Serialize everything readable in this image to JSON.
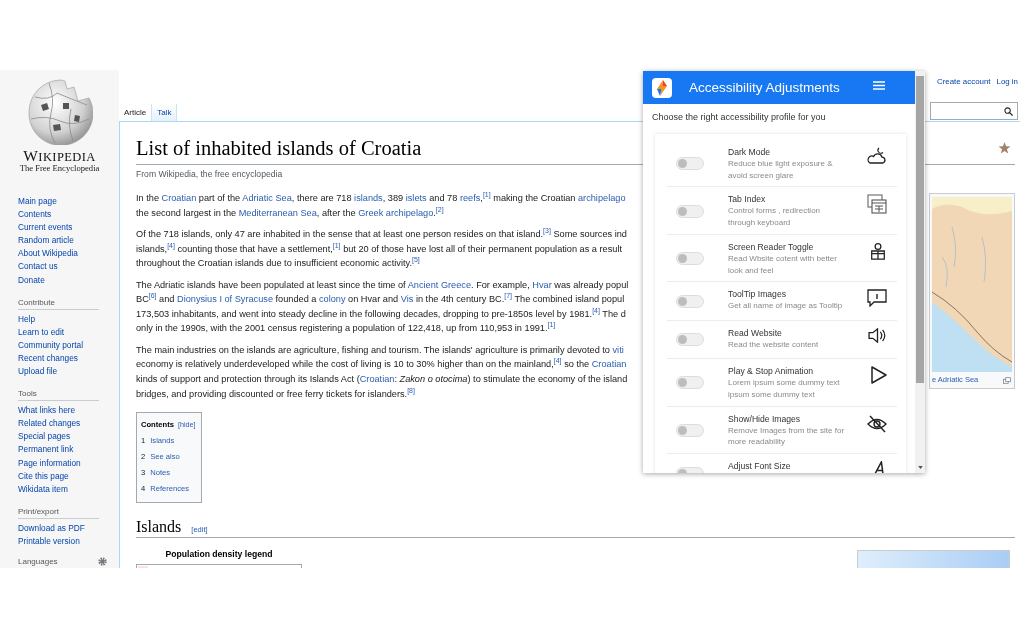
{
  "sidebar": {
    "wordmark": "WIKIPEDIA",
    "tagline": "The Free Encyclopedia",
    "sections": [
      {
        "items": [
          "Main page",
          "Contents",
          "Current events",
          "Random article",
          "About Wikipedia",
          "Contact us",
          "Donate"
        ]
      },
      {
        "heading": "Contribute",
        "items": [
          "Help",
          "Learn to edit",
          "Community portal",
          "Recent changes",
          "Upload file"
        ]
      },
      {
        "heading": "Tools",
        "items": [
          "What links here",
          "Related changes",
          "Special pages",
          "Permanent link",
          "Page information",
          "Cite this page",
          "Wikidata item"
        ]
      },
      {
        "heading": "Print/export",
        "items": [
          "Download as PDF",
          "Printable version"
        ]
      }
    ],
    "languages_heading": "Languages"
  },
  "tabs": [
    {
      "label": "Article",
      "selected": true
    },
    {
      "label": "Talk",
      "selected": false
    }
  ],
  "personal_links": [
    "Create account",
    "Log in"
  ],
  "article": {
    "title": "List of inhabited islands of Croatia",
    "tagline": "From Wikipedia, the free encyclopedia",
    "paragraphs": [
      {
        "lines": [
          [
            {
              "kind": "text",
              "text": "In the "
            },
            {
              "kind": "link",
              "text": "Croatian"
            },
            {
              "kind": "text",
              "text": " part of the "
            },
            {
              "kind": "link",
              "text": "Adriatic Sea"
            },
            {
              "kind": "text",
              "text": ", there are 718 "
            },
            {
              "kind": "link",
              "text": "islands"
            },
            {
              "kind": "text",
              "text": ", 389 "
            },
            {
              "kind": "link",
              "text": "islets"
            },
            {
              "kind": "text",
              "text": " and 78 "
            },
            {
              "kind": "link",
              "text": "reefs"
            },
            {
              "kind": "text",
              "text": ","
            },
            {
              "kind": "ref",
              "text": "[1]"
            },
            {
              "kind": "text",
              "text": " making the Croatian "
            },
            {
              "kind": "link",
              "text": "archipelago"
            }
          ],
          [
            {
              "kind": "text",
              "text": "the second largest in the "
            },
            {
              "kind": "link",
              "text": "Mediterranean Sea"
            },
            {
              "kind": "text",
              "text": ", after the "
            },
            {
              "kind": "link",
              "text": "Greek archipelago"
            },
            {
              "kind": "text",
              "text": "."
            },
            {
              "kind": "ref",
              "text": "[2]"
            }
          ]
        ]
      },
      {
        "lines": [
          [
            {
              "kind": "text",
              "text": "Of the 718 islands, only 47 are inhabited in the sense that at least one person resides on that island."
            },
            {
              "kind": "ref",
              "text": "[3]"
            },
            {
              "kind": "text",
              "text": " Some sources ind"
            }
          ],
          [
            {
              "kind": "text",
              "text": "islands,"
            },
            {
              "kind": "ref",
              "text": "[4]"
            },
            {
              "kind": "text",
              "text": " counting those that have a settlement,"
            },
            {
              "kind": "ref",
              "text": "[1]"
            },
            {
              "kind": "text",
              "text": " but 20 of those have lost all of their permanent population as a result"
            }
          ],
          [
            {
              "kind": "text",
              "text": "throughout the Croatian islands due to insufficient economic activity."
            },
            {
              "kind": "ref",
              "text": "[5]"
            }
          ]
        ]
      },
      {
        "lines": [
          [
            {
              "kind": "text",
              "text": "The Adriatic islands have been populated at least since the time of "
            },
            {
              "kind": "link",
              "text": "Ancient Greece"
            },
            {
              "kind": "text",
              "text": ". For example, "
            },
            {
              "kind": "link",
              "text": "Hvar"
            },
            {
              "kind": "text",
              "text": " was already popul"
            }
          ],
          [
            {
              "kind": "text",
              "text": "BC"
            },
            {
              "kind": "ref",
              "text": "[6]"
            },
            {
              "kind": "text",
              "text": " and "
            },
            {
              "kind": "link",
              "text": "Dionysius I of Syracuse"
            },
            {
              "kind": "text",
              "text": " founded a "
            },
            {
              "kind": "link",
              "text": "colony"
            },
            {
              "kind": "text",
              "text": " on Hvar and "
            },
            {
              "kind": "link",
              "text": "Vis"
            },
            {
              "kind": "text",
              "text": " in the 4th century BC."
            },
            {
              "kind": "ref",
              "text": "[7]"
            },
            {
              "kind": "text",
              "text": " The combined island popul"
            }
          ],
          [
            {
              "kind": "text",
              "text": "173,503 inhabitants, and went into steady decline in the following decades, dropping to pre-1850s level by 1981."
            },
            {
              "kind": "ref",
              "text": "[4]"
            },
            {
              "kind": "text",
              "text": " The d"
            }
          ],
          [
            {
              "kind": "text",
              "text": "only in the 1990s, with the 2001 census registering a population of 122,418, up from 110,953 in 1991."
            },
            {
              "kind": "ref",
              "text": "[1]"
            }
          ]
        ]
      },
      {
        "lines": [
          [
            {
              "kind": "text",
              "text": "The main industries on the islands are agriculture, fishing and tourism. The islands' agriculture is primarily devoted to "
            },
            {
              "kind": "link",
              "text": "viti"
            }
          ],
          [
            {
              "kind": "text",
              "text": "economy is relatively underdeveloped while the cost of living is 10 to 30% higher than on the mainland,"
            },
            {
              "kind": "ref",
              "text": "[4]"
            },
            {
              "kind": "text",
              "text": " so the "
            },
            {
              "kind": "link",
              "text": "Croatian"
            }
          ],
          [
            {
              "kind": "text",
              "text": "kinds of support and protection through its Islands Act ("
            },
            {
              "kind": "link",
              "text": "Croatian"
            },
            {
              "kind": "text",
              "text": ": "
            },
            {
              "kind": "italic",
              "text": "Zakon o otocima"
            },
            {
              "kind": "text",
              "text": ") to stimulate the economy of the island"
            }
          ],
          [
            {
              "kind": "text",
              "text": "bridges, and providing discounted or free ferry tickets for islanders."
            },
            {
              "kind": "ref",
              "text": "[8]"
            }
          ]
        ]
      }
    ],
    "thumbnail": {
      "caption": "e Adriatic Sea"
    },
    "contents": {
      "title": "Contents",
      "toggle": "[hide]",
      "items": [
        {
          "number": "1",
          "label": "Islands"
        },
        {
          "number": "2",
          "label": "See also"
        },
        {
          "number": "3",
          "label": "Notes"
        },
        {
          "number": "4",
          "label": "References"
        }
      ]
    },
    "section": {
      "heading": "Islands",
      "edit": "[edit]"
    },
    "legend": {
      "title": "Population density legend"
    }
  },
  "accessibility_panel": {
    "title": "Accessibility Adjustments",
    "subtitle": "Choose the right accessibility profile for you",
    "options": [
      {
        "title": "Dark Mode",
        "description": "Reduce blue light exposure & avoid screen glare",
        "on": false
      },
      {
        "title": "Tab Index",
        "description": "Control forms , redirection through keyboard",
        "on": false
      },
      {
        "title": "Screen Reader Toggle",
        "description": "Read Wbsite cotent with better look and feel",
        "on": false
      },
      {
        "title": "ToolTip Images",
        "description": "Get all name of image as Tooltip",
        "on": false
      },
      {
        "title": "Read Website",
        "description": "Read the website content",
        "on": false
      },
      {
        "title": "Play & Stop Animation",
        "description": "Lorem ipsum some dummy text ipsum some dummy text",
        "on": false
      },
      {
        "title": "Show/Hide Images",
        "description": "Remove Images from the site for more readability",
        "on": false
      },
      {
        "title": "Adjust Font Size",
        "on": false
      }
    ]
  }
}
